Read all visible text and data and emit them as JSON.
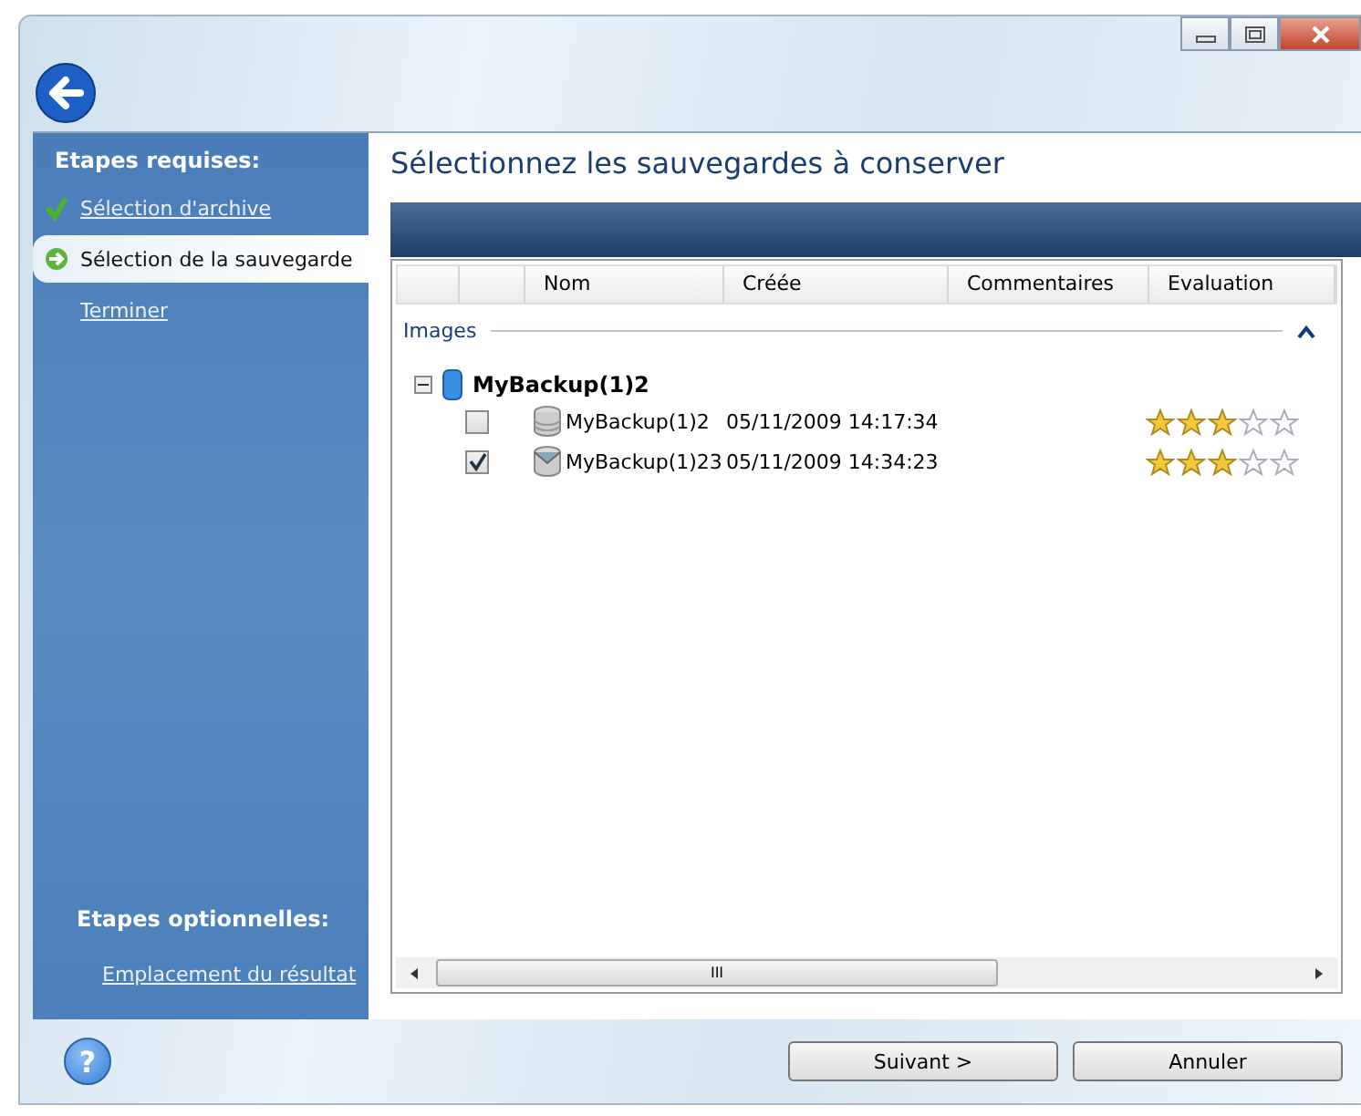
{
  "sidebar": {
    "required_title": "Etapes requises:",
    "required_steps": [
      {
        "label": "Sélection d'archive",
        "kind": "done",
        "selected": false
      },
      {
        "label": "Sélection de la sauvegarde",
        "kind": "current",
        "selected": true
      },
      {
        "label": "Terminer",
        "kind": "pending",
        "selected": false
      }
    ],
    "optional_title": "Etapes optionnelles:",
    "optional_steps": [
      {
        "label": "Emplacement du résultat",
        "selected": false
      }
    ]
  },
  "page_title": "Sélectionnez les sauvegardes à conserver",
  "table": {
    "columns": [
      "Nom",
      "Créée",
      "Commentaires",
      "Evaluation"
    ],
    "group": "Images",
    "archive": {
      "name": "MyBackup(1)2",
      "expanded": true
    },
    "rows": [
      {
        "checked": false,
        "kind": "full",
        "name": "MyBackup(1)2",
        "created": "05/11/2009 14:17:34",
        "stars": 3
      },
      {
        "checked": true,
        "kind": "incremental",
        "name": "MyBackup(1)23",
        "created": "05/11/2009 14:34:23",
        "stars": 3
      }
    ],
    "scroll_grip": "III"
  },
  "help": "?",
  "buttons": [
    {
      "label": "Suivant >"
    },
    {
      "label": "Annuler"
    }
  ]
}
